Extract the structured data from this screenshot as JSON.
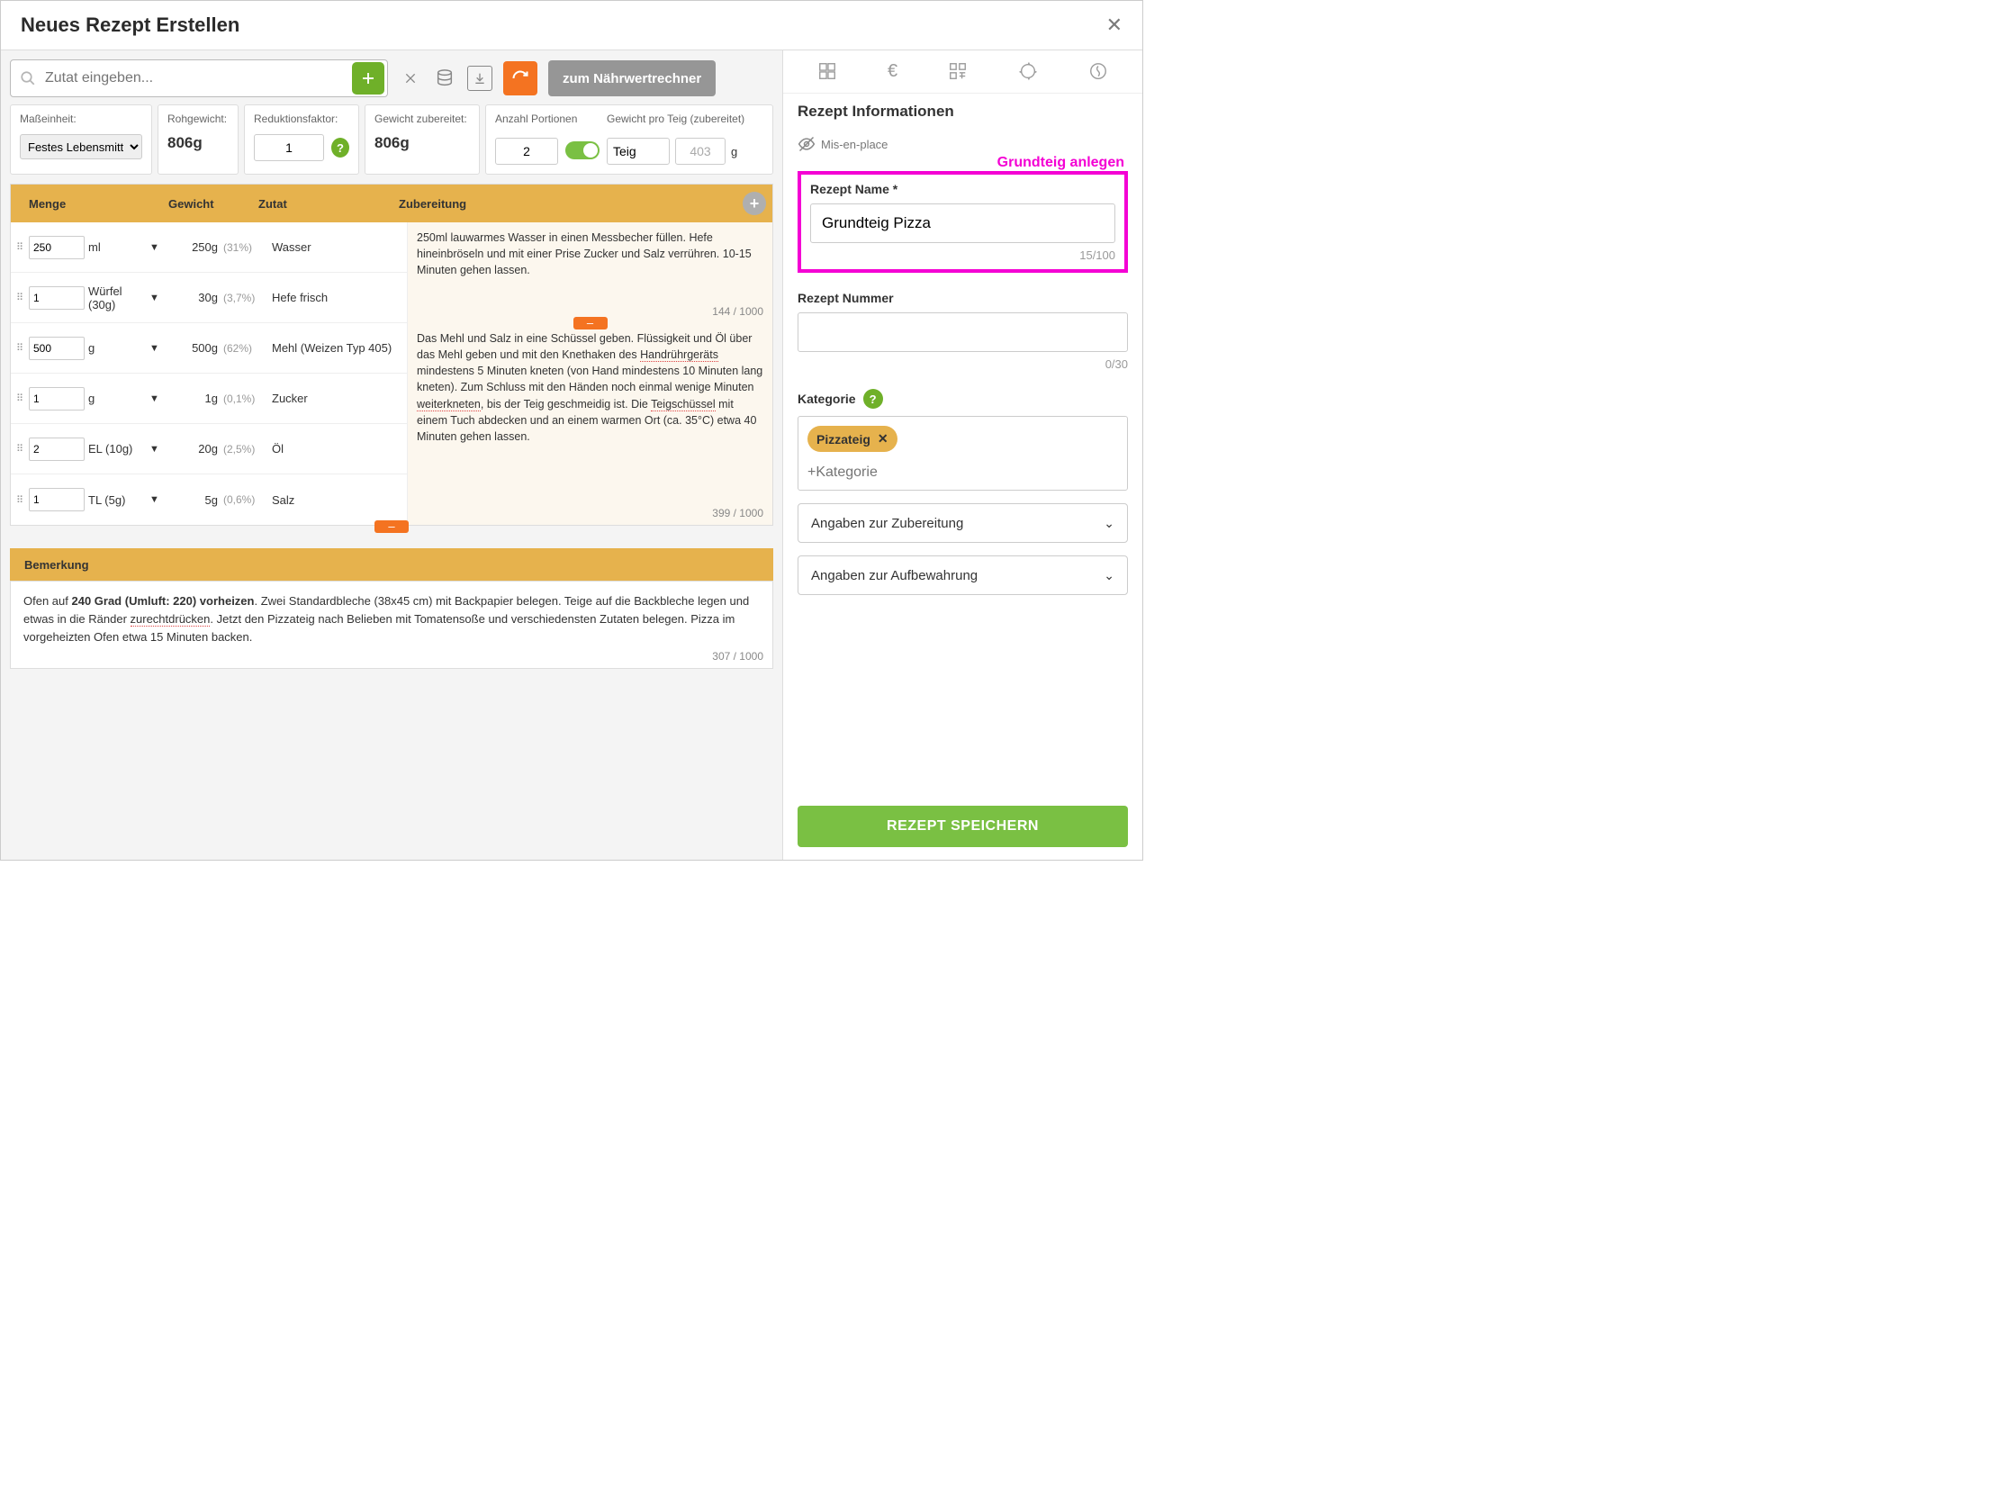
{
  "header": {
    "title": "Neues Rezept Erstellen"
  },
  "toolbar": {
    "search_placeholder": "Zutat eingeben...",
    "to_calc_label": "zum Nährwertrechner"
  },
  "params": {
    "unit_label": "Maßeinheit:",
    "unit_value": "Festes Lebensmittel (g)",
    "raw_label": "Rohgewicht:",
    "raw_value": "806g",
    "reduction_label": "Reduktionsfaktor:",
    "reduction_value": "1",
    "cooked_label": "Gewicht zubereitet:",
    "cooked_value": "806g",
    "portions_label": "Anzahl Portionen",
    "portions_value": "2",
    "portion_unit": "Teig",
    "weight_per_label": "Gewicht pro Teig (zubereitet)",
    "weight_per_value": "403",
    "weight_per_unit": "g"
  },
  "table": {
    "head_menge": "Menge",
    "head_gewicht": "Gewicht",
    "head_zutat": "Zutat",
    "head_zubereitung": "Zubereitung",
    "rows": [
      {
        "qty": "250",
        "unit": "ml",
        "weight": "250g",
        "pct": "(31%)",
        "name": "Wasser"
      },
      {
        "qty": "1",
        "unit": "Würfel (30g)",
        "weight": "30g",
        "pct": "(3,7%)",
        "name": "Hefe frisch"
      },
      {
        "qty": "500",
        "unit": "g",
        "weight": "500g",
        "pct": "(62%)",
        "name": "Mehl (Weizen Typ 405)"
      },
      {
        "qty": "1",
        "unit": "g",
        "weight": "1g",
        "pct": "(0,1%)",
        "name": "Zucker"
      },
      {
        "qty": "2",
        "unit": "EL (10g)",
        "weight": "20g",
        "pct": "(2,5%)",
        "name": "Öl"
      },
      {
        "qty": "1",
        "unit": "TL (5g)",
        "weight": "5g",
        "pct": "(0,6%)",
        "name": "Salz"
      }
    ],
    "prep1": "250ml lauwarmes Wasser in einen Messbecher füllen. Hefe hineinbröseln und mit einer Prise Zucker und Salz verrühren. 10-15 Minuten gehen lassen.",
    "prep1_count": "144 / 1000",
    "prep2a": "Das Mehl und Salz in eine Schüssel geben. Flüssigkeit und Öl über das Mehl geben und mit den Knethaken des ",
    "prep2_u1": "Handrührgeräts",
    "prep2b": " mindestens 5 Minuten kneten (von Hand mindestens 10 Minuten lang kneten). Zum Schluss mit den Händen noch einmal wenige Minuten ",
    "prep2_u2": "weiterkneten",
    "prep2c": ", bis der Teig geschmeidig ist. Die ",
    "prep2_u3": "Teigschüssel",
    "prep2d": " mit einem Tuch abdecken und an einem warmen Ort (ca. 35°C) etwa 40 Minuten gehen lassen.",
    "prep2_count": "399 / 1000"
  },
  "bemerkung": {
    "head": "Bemerkung",
    "t1": "Ofen auf ",
    "bold1": "240 Grad (Umluft: 220) vorheizen",
    "t2": ". Zwei Standardbleche (38x45 cm) mit Backpapier belegen. Teige auf die Backbleche legen und etwas in die Ränder ",
    "u1": "zurechtdrücken",
    "t3": ". Jetzt den Pizzateig nach Belieben mit Tomatensoße und verschiedensten Zutaten belegen. Pizza im vorgeheizten Ofen etwa 15 Minuten backen.",
    "count": "307 / 1000"
  },
  "right": {
    "section_title": "Rezept Informationen",
    "mis_label": "Mis-en-place",
    "annotation": "Grundteig anlegen",
    "name_label": "Rezept Name *",
    "name_value": "Grundteig Pizza",
    "name_count": "15/100",
    "number_label": "Rezept Nummer",
    "number_value": "",
    "number_count": "0/30",
    "kategorie_label": "Kategorie",
    "chip": "Pizzateig",
    "chip_placeholder": "+Kategorie",
    "acc1": "Angaben zur Zubereitung",
    "acc2": "Angaben zur Aufbewahrung",
    "save_label": "REZEPT SPEICHERN"
  }
}
